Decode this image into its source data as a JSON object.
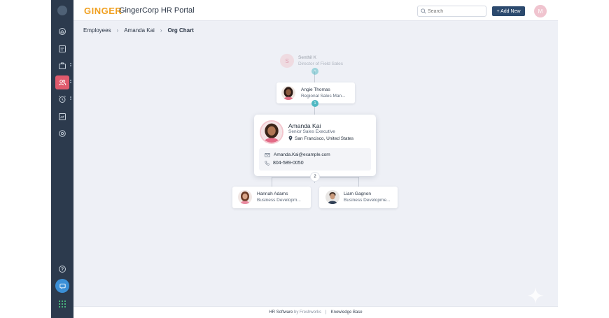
{
  "app": {
    "brand": "GINGER",
    "title": "GingerCorp HR Portal",
    "search_placeholder": "Search",
    "add_new_label": "+ Add New",
    "user_initial": "M"
  },
  "breadcrumb": {
    "items": [
      "Employees",
      "Amanda Kai",
      "Org Chart"
    ]
  },
  "sidebar": {
    "icons": [
      "home-icon",
      "id-card-icon",
      "briefcase-icon",
      "people-icon",
      "alarm-clock-icon",
      "report-icon",
      "settings-icon",
      "help-icon",
      "chat-icon",
      "apps-grid-icon"
    ],
    "active": "people-icon"
  },
  "org_chart": {
    "top_manager": {
      "name": "Senthil K",
      "role": "Director of Field Sales",
      "initial": "S"
    },
    "manager": {
      "name": "Angie Thomas",
      "role": "Regional Sales Man..."
    },
    "manager_badge": "1",
    "focus": {
      "name": "Amanda Kai",
      "role": "Senior Sales Executive",
      "location": "San Francisco, United States",
      "email": "Amanda.Kai@example.com",
      "phone": "804-589-0050"
    },
    "reports_count": "2",
    "reports": [
      {
        "name": "Hannah Adams",
        "role": "Business Developm..."
      },
      {
        "name": "Liam Gagnon",
        "role": "Business Developme..."
      }
    ]
  },
  "footer": {
    "hr_software": "HR Software",
    "by": "by Freshworks",
    "separator": "|",
    "knowledge_base": "Knowledge Base"
  },
  "colors": {
    "sidebar_bg": "#2c3a4d",
    "active_item": "#e05a6d",
    "brand_orange": "#f0a020",
    "primary_button": "#2c4a6e",
    "badge_teal": "#4fb8c2",
    "canvas_bg": "#eef0f6"
  }
}
